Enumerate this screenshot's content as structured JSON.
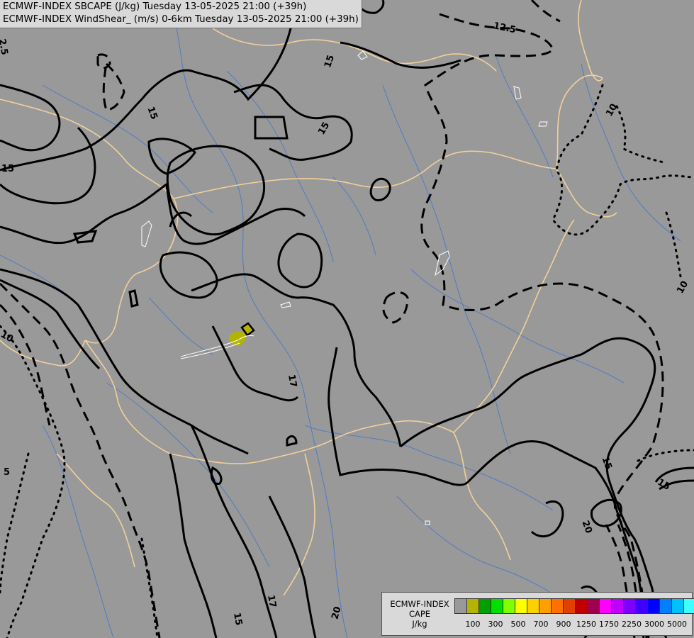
{
  "header": {
    "line1": "ECMWF-INDEX SBCAPE (J/kg) Tuesday 13-05-2025 21:00 (+39h)",
    "line2": "ECMWF-INDEX WindShear_ (m/s) 0-6km Tuesday 13-05-2025 21:00 (+39h)"
  },
  "map": {
    "background_color": "#999999",
    "border_color": "#f2d09a",
    "river_color": "#4a78c8",
    "contour_color": "#000000",
    "cape_patch_color": "#b3b300",
    "contour_labels": [
      "12.5",
      "15",
      "15",
      "15",
      "15",
      "10",
      "10",
      "10",
      "17",
      "17",
      "15",
      "15",
      "20",
      "20",
      "15",
      "5",
      "2.5"
    ]
  },
  "legend": {
    "title_line1": "ECMWF-INDEX",
    "title_line2": "CAPE",
    "title_line3": "J/kg",
    "colors": [
      "#999999",
      "#b3b300",
      "#00a000",
      "#00e000",
      "#80ff00",
      "#ffff00",
      "#ffd000",
      "#ffa000",
      "#ff7000",
      "#e04000",
      "#c00000",
      "#a00050",
      "#ff00ff",
      "#c000ff",
      "#8000ff",
      "#4000ff",
      "#0000ff",
      "#0080ff",
      "#00c0ff",
      "#40ffff",
      "#ffffff"
    ],
    "ticks": [
      "100",
      "300",
      "500",
      "700",
      "900",
      "1250",
      "1750",
      "2250",
      "3000",
      "5000"
    ]
  }
}
